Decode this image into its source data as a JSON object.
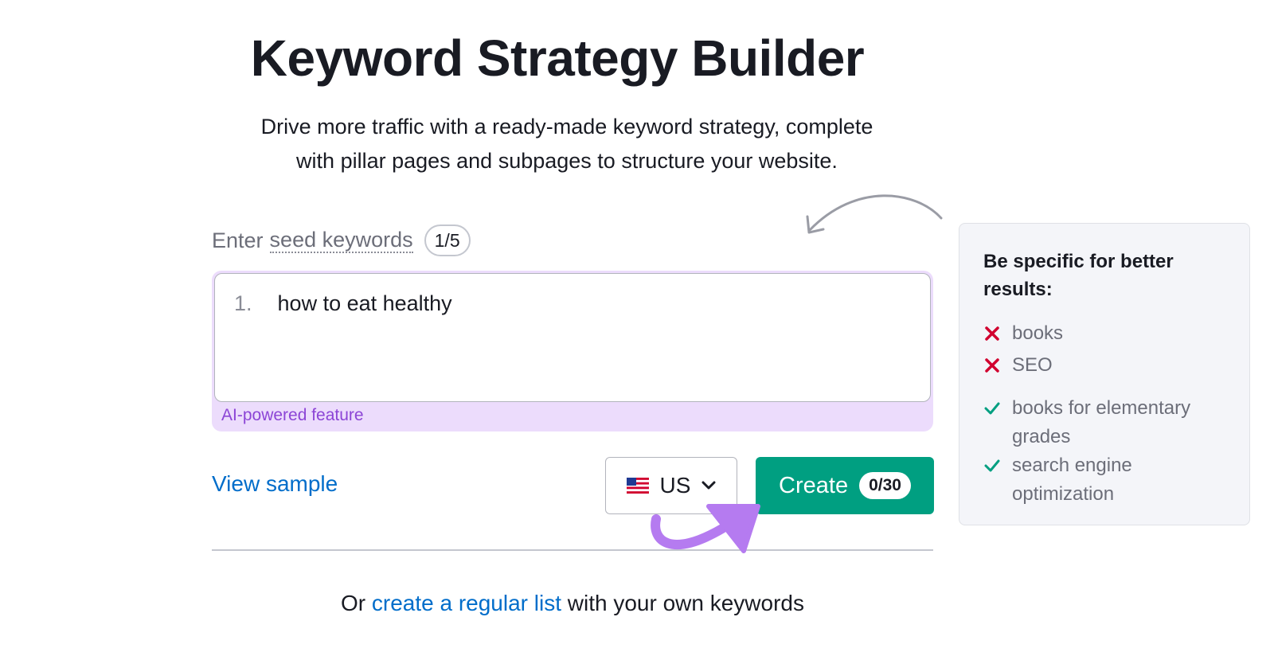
{
  "header": {
    "title": "Keyword Strategy Builder",
    "subtitle_line1": "Drive more traffic with a ready-made keyword strategy, complete",
    "subtitle_line2": "with pillar pages and subpages to structure your website."
  },
  "form": {
    "label_prefix": "Enter",
    "label_link": "seed keywords",
    "keyword_count": "1/5",
    "keywords": [
      {
        "number": "1.",
        "text": "how to eat healthy"
      }
    ],
    "ai_label": "AI-powered feature",
    "view_sample": "View sample",
    "country": {
      "code": "US",
      "flag_icon": "us-flag-icon"
    },
    "create_button": {
      "label": "Create",
      "count": "0/30"
    }
  },
  "footer": {
    "prefix": "Or",
    "link": "create a regular list",
    "suffix": "with your own keywords"
  },
  "tips": {
    "title": "Be specific for better results:",
    "bad": [
      "books",
      "SEO"
    ],
    "good": [
      "books for elementary grades",
      "search engine optimization"
    ]
  },
  "colors": {
    "accent_green": "#009f81",
    "link_blue": "#006dca",
    "ai_purple": "#8c45d6",
    "ai_bg": "#ecdcfc",
    "error_red": "#d1002f",
    "check_green": "#009f81"
  }
}
